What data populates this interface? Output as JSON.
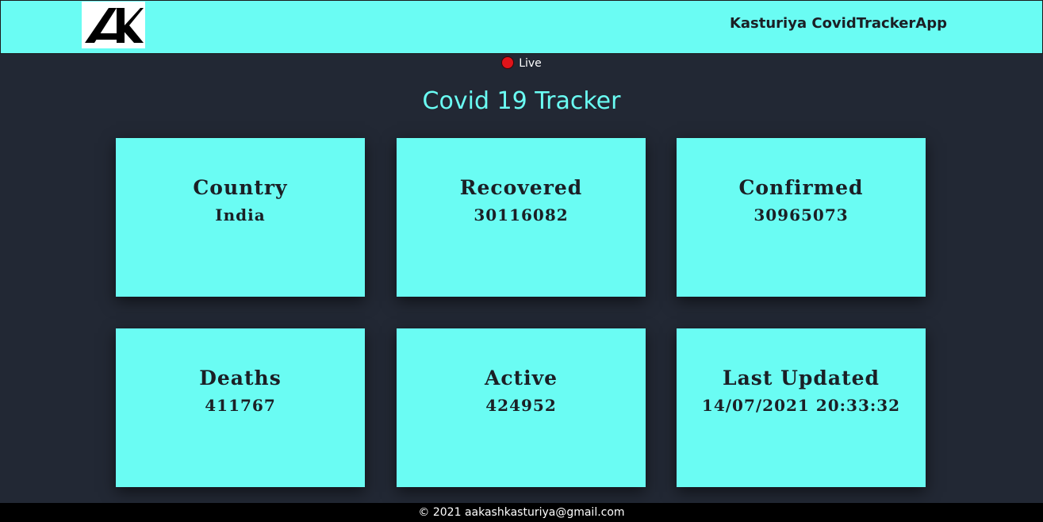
{
  "header": {
    "logo_icon": "ak-logo-icon",
    "brand": "Kasturiya CovidTrackerApp"
  },
  "live": {
    "label": "Live",
    "dot_color": "#e0141a"
  },
  "title": "Covid 19 Tracker",
  "cards": [
    {
      "label": "Country",
      "value": "India"
    },
    {
      "label": "Recovered",
      "value": "30116082"
    },
    {
      "label": "Confirmed",
      "value": "30965073"
    },
    {
      "label": "Deaths",
      "value": "411767"
    },
    {
      "label": "Active",
      "value": "424952"
    },
    {
      "label": "Last Updated",
      "value": "14/07/2021 20:33:32"
    }
  ],
  "footer": {
    "text": "© 2021 aakashkasturiya@gmail.com"
  },
  "colors": {
    "accent": "#6afcf3",
    "background": "#222834",
    "footer": "#000000"
  }
}
